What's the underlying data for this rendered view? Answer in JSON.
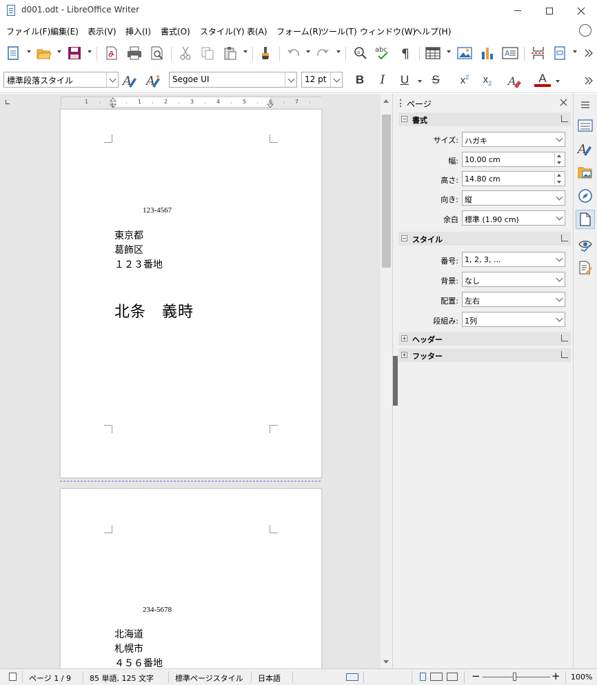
{
  "window": {
    "title": "d001.odt - LibreOffice Writer"
  },
  "menu": [
    "ファイル(F)",
    "編集(E)",
    "表示(V)",
    "挿入(I)",
    "書式(O)",
    "スタイル(Y)",
    "表(A)",
    "フォーム(R)",
    "ツール(T)",
    "ウィンドウ(W)",
    "ヘルプ(H)"
  ],
  "format_toolbar": {
    "paragraph_style": "標準段落スタイル",
    "font_name": "Segoe UI",
    "font_size": "12 pt"
  },
  "ruler": {
    "numbers": [
      "1",
      "1",
      "1",
      "2",
      "3",
      "4",
      "5",
      "6",
      "7"
    ]
  },
  "pages": [
    {
      "postal": "123-4567",
      "address": [
        "東京都",
        "葛飾区",
        "１２３番地"
      ],
      "name": "北条　義時"
    },
    {
      "postal": "234-5678",
      "address": [
        "北海道",
        "札幌市",
        "４５６番地"
      ]
    }
  ],
  "sidebar": {
    "title": "ページ",
    "format": {
      "heading": "書式",
      "size_label": "サイズ:",
      "size_value": "ハガキ",
      "width_label": "幅:",
      "width_value": "10.00 cm",
      "height_label": "高さ:",
      "height_value": "14.80 cm",
      "orientation_label": "向き:",
      "orientation_value": "縦",
      "margin_label": "余白",
      "margin_value": "標準 (1.90 cm)"
    },
    "style": {
      "heading": "スタイル",
      "number_label": "番号:",
      "number_value": "1, 2, 3, ...",
      "background_label": "背景:",
      "background_value": "なし",
      "layout_label": "配置:",
      "layout_value": "左右",
      "columns_label": "段組み:",
      "columns_value": "1列"
    },
    "header": {
      "heading": "ヘッダー"
    },
    "footer": {
      "heading": "フッター"
    }
  },
  "status": {
    "page": "ページ 1 / 9",
    "words": "85 単語, 125 文字",
    "page_style": "標準ページスタイル",
    "language": "日本語",
    "zoom": "100%"
  },
  "colors": {
    "accent_blue": "#2f6fb5",
    "font_color_red": "#c00000",
    "save_purple": "#8b1c62"
  }
}
